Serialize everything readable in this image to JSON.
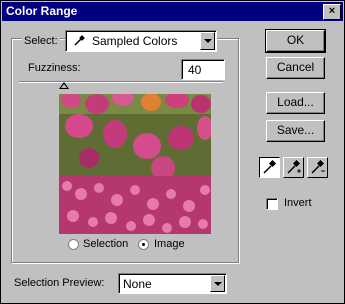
{
  "window": {
    "title": "Color Range",
    "close_glyph": "×"
  },
  "select": {
    "label": "Select:",
    "value": "Sampled Colors",
    "icon": "eyedropper-icon"
  },
  "fuzziness": {
    "label": "Fuzziness:",
    "value": "40"
  },
  "preview_mode": {
    "selection_label": "Selection",
    "image_label": "Image",
    "selected": "Image"
  },
  "selection_preview": {
    "label": "Selection Preview:",
    "value": "None"
  },
  "buttons": {
    "ok": "OK",
    "cancel": "Cancel",
    "load": "Load...",
    "save": "Save..."
  },
  "tools": [
    "eyedropper-icon",
    "eyedropper-plus-icon",
    "eyedropper-minus-icon"
  ],
  "invert": {
    "label": "Invert",
    "checked": false
  },
  "colors": {
    "title_bar": "#000080",
    "dialog": "#c0c0c0"
  }
}
